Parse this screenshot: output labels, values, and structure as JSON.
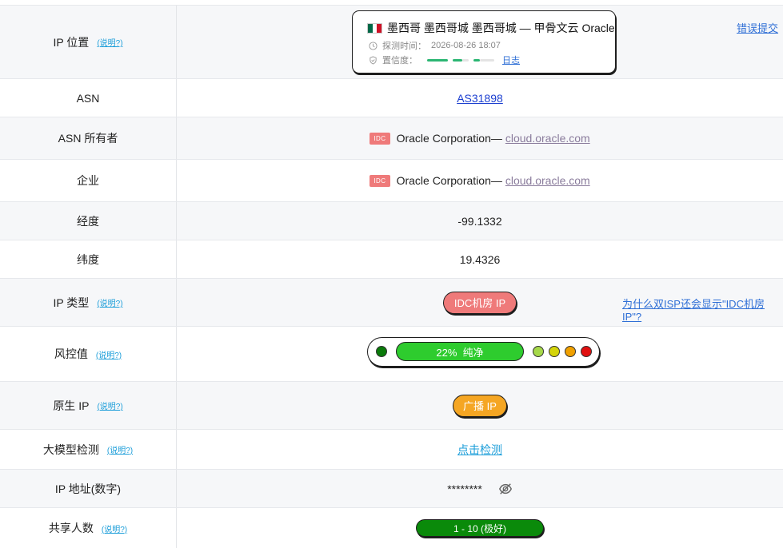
{
  "rows": {
    "ip_location": {
      "label": "IP 位置",
      "help": "(说明?)",
      "country": "墨西哥 墨西哥城 墨西哥城 — 甲骨文云 Oracle",
      "probe_time_label": "探测时间：",
      "probe_time": "2026-08-26 18:07",
      "confidence_label": "置信度：",
      "log_link": "日志",
      "report_link": "错误提交",
      "flag_colors": [
        "#006847",
        "#ffffff",
        "#ce1126"
      ],
      "confidence_bar_colors": [
        "#2bb673",
        "#2bb673",
        "#2bb673",
        "#e4e4e4"
      ]
    },
    "asn": {
      "label": "ASN",
      "value": "AS31898"
    },
    "asn_owner": {
      "label": "ASN 所有者",
      "tag": "IDC",
      "name": "Oracle Corporation—",
      "domain": "cloud.oracle.com"
    },
    "company": {
      "label": "企业",
      "tag": "IDC",
      "name": "Oracle Corporation—",
      "domain": "cloud.oracle.com"
    },
    "longitude": {
      "label": "经度",
      "value": "-99.1332"
    },
    "latitude": {
      "label": "纬度",
      "value": "19.4326"
    },
    "ip_type": {
      "label": "IP 类型",
      "help": "(说明?)",
      "value": "IDC机房 IP",
      "side_link": "为什么双ISP还会显示\"IDC机房IP\"?",
      "pill_color": "#ef7a7a"
    },
    "risk": {
      "label": "风控值",
      "help": "(说明?)",
      "value": "22%  纯净",
      "dot_colors": [
        "#0a7a0a",
        "#a6d94a",
        "#d4d40a",
        "#f0a000",
        "#e01010"
      ],
      "bar_color": "#2ecc2e"
    },
    "native_ip": {
      "label": "原生 IP",
      "help": "(说明?)",
      "value": "广播 IP",
      "pill_color": "#f5a623"
    },
    "llm_check": {
      "label": "大模型检测",
      "help": "(说明?)",
      "value": "点击检测"
    },
    "ip_numeric": {
      "label": "IP 地址(数字)",
      "value": "********",
      "icon": "eye-off-icon"
    },
    "shared_users": {
      "label": "共享人数",
      "help": "(说明?)",
      "value": "1 - 10 (极好)",
      "pill_color": "#0a8a0a"
    }
  }
}
